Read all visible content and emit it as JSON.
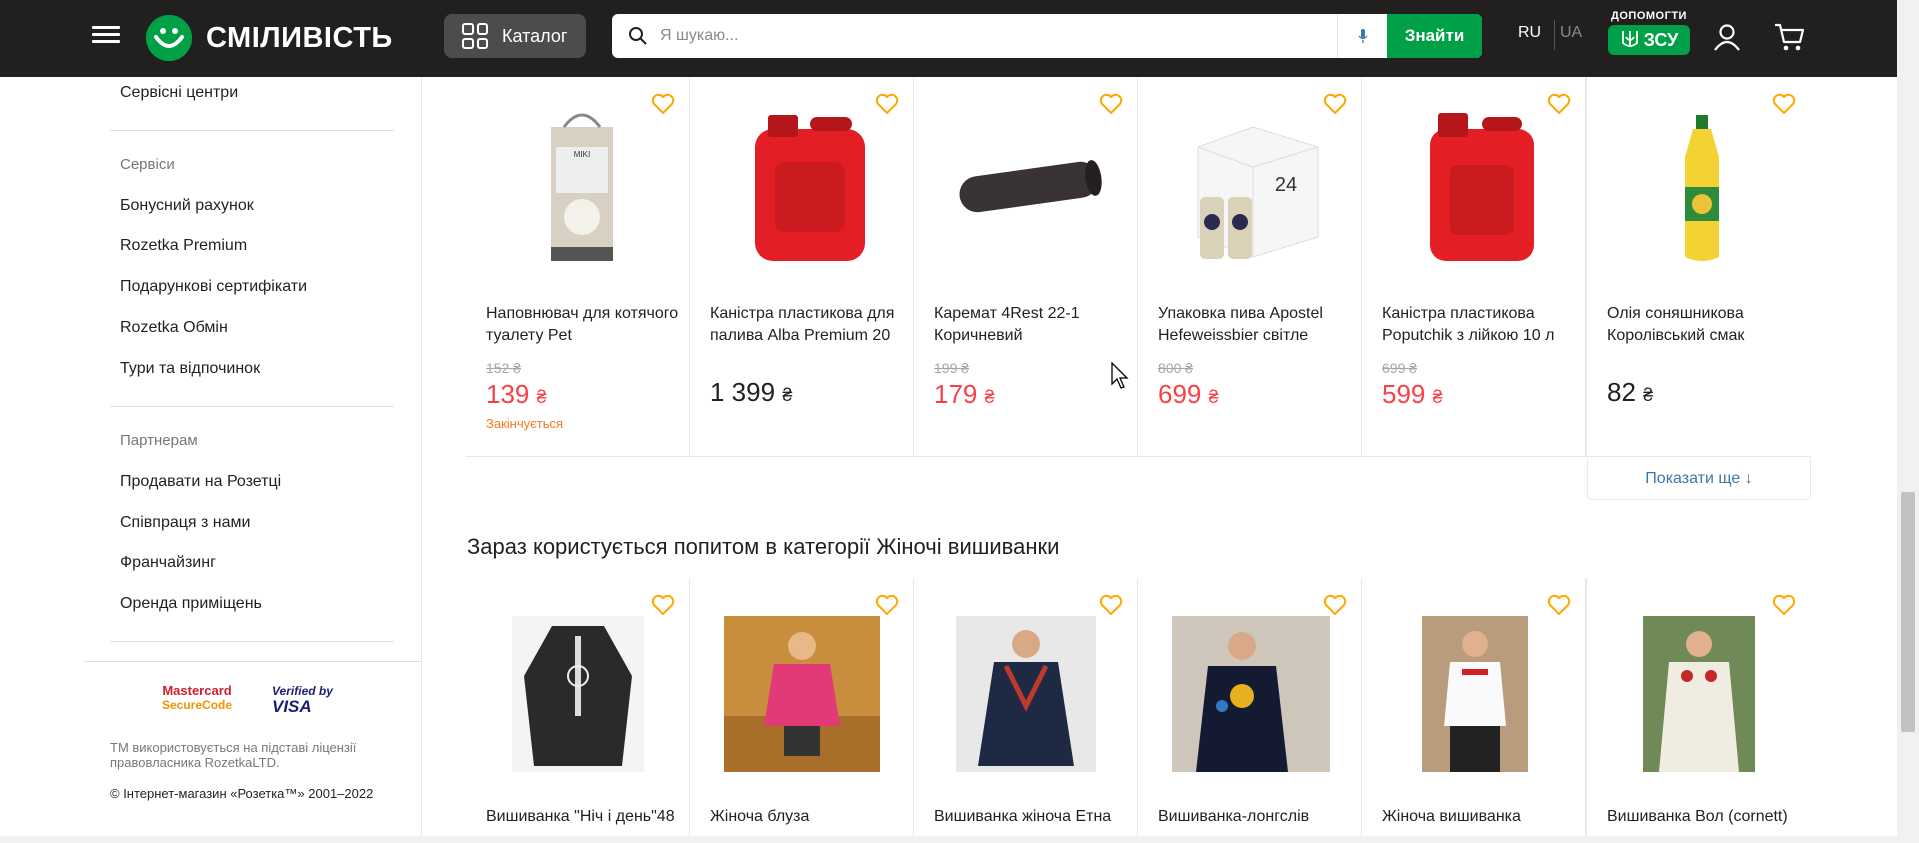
{
  "header": {
    "logo_text": "СМІЛИВІСТЬ",
    "catalog_label": "Каталог",
    "search_placeholder": "Я шукаю...",
    "find_label": "Знайти",
    "lang_ru": "RU",
    "lang_ua": "UA",
    "help_label": "ДОПОМОГТИ",
    "help_badge": "ЗСУ"
  },
  "sidebar": {
    "service_centers": "Сервісні центри",
    "services_heading": "Сервіси",
    "services": [
      "Бонусний рахунок",
      "Rozetka Premium",
      "Подарункові сертифікати",
      "Rozetka Обмін",
      "Тури та відпочинок"
    ],
    "partners_heading": "Партнерам",
    "partners": [
      "Продавати на Розетці",
      "Співпраця з нами",
      "Франчайзинг",
      "Оренда приміщень"
    ],
    "mastercard_line1": "Mastercard",
    "mastercard_line2": "SecureCode",
    "visa_line1": "Verified by",
    "visa_line2": "VISA",
    "legal": "ТМ використовується на підставі ліцензії правовласника RozetkaLTD.",
    "copyright": "© Інтернет-магазин «Розетка™» 2001–2022"
  },
  "products_row1": [
    {
      "title": "Наповнювач для котячого туалету Pet",
      "old_price": "152 ₴",
      "price": "139",
      "status": "Закінчується"
    },
    {
      "title": "Каністра пластикова для палива Alba Premium 20",
      "old_price": "",
      "price": "1 399",
      "status": ""
    },
    {
      "title": "Каремат 4Rest 22-1 Коричневий",
      "old_price": "199 ₴",
      "price": "179",
      "status": ""
    },
    {
      "title": "Упаковка пива Apostel Hefeweissbier світле",
      "old_price": "800 ₴",
      "price": "699",
      "status": ""
    },
    {
      "title": "Каністра пластикова Poputchik з лійкою 10 л",
      "old_price": "699 ₴",
      "price": "599",
      "status": ""
    },
    {
      "title": "Олія соняшникова Королівський смак",
      "old_price": "",
      "price": "82",
      "status": ""
    }
  ],
  "currency": "₴",
  "show_more": "Показати ще ↓",
  "section_title": "Зараз користується попитом в категорії Жіночі вишиванки",
  "products_row2": [
    {
      "title": "Вишиванка \"Ніч і день\"48"
    },
    {
      "title": "Жіноча блуза"
    },
    {
      "title": "Вишиванка жіноча Етна"
    },
    {
      "title": "Вишиванка-лонгслів"
    },
    {
      "title": "Жіноча вишиванка"
    },
    {
      "title": "Вишиванка Вол (cornett)"
    }
  ],
  "colors": {
    "brand": "#00a046",
    "header_bg": "#221f1f",
    "sale_price": "#f84147",
    "heart": "#ffa900",
    "link": "#3e77aa"
  }
}
